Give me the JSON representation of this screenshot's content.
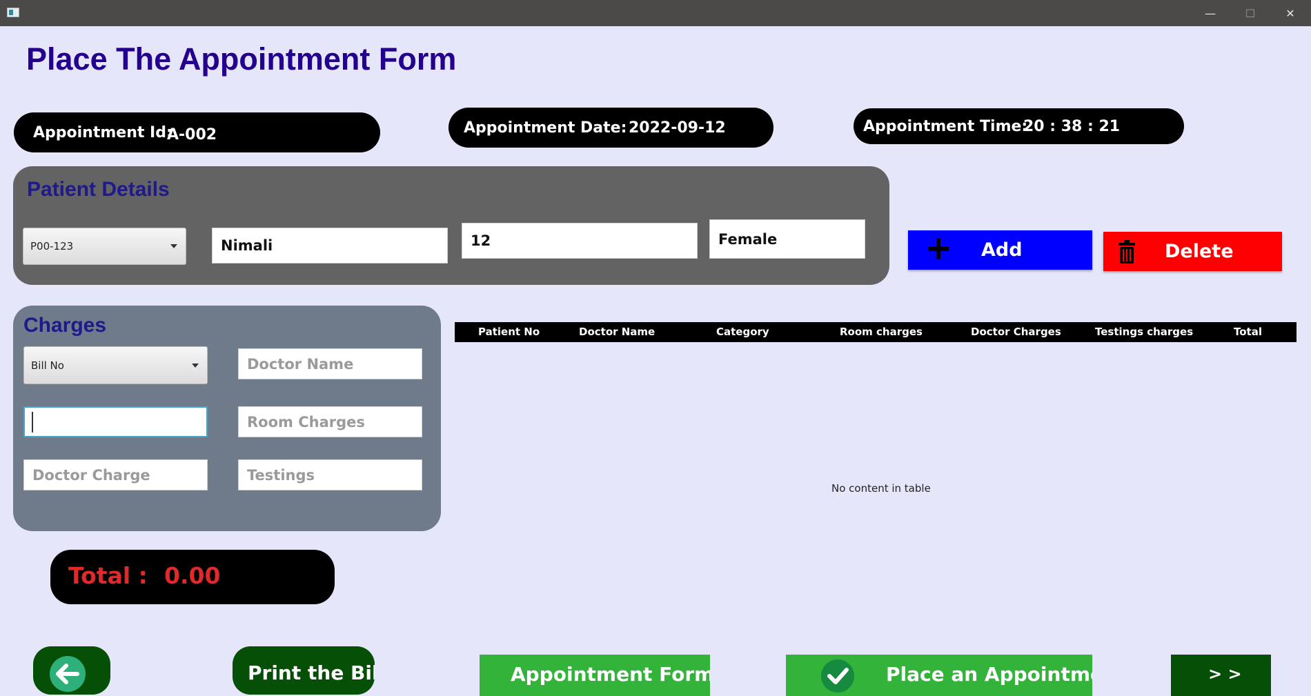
{
  "window": {
    "minimize_icon": "—",
    "maximize_icon": "☐",
    "close_icon": "✕"
  },
  "page_title": "Place The Appointment Form",
  "info": {
    "appointment_id_label": "Appointment Id:",
    "appointment_id_value": "A-002",
    "appointment_date_label": "Appointment Date:",
    "appointment_date_value": "2022-09-12",
    "appointment_time_label": "Appointment Time:",
    "appointment_time_value": "20 : 38 : 21"
  },
  "patient": {
    "heading": "Patient Details",
    "patient_id_selected": "P00-123",
    "name_value": "Nimali",
    "age_value": "12",
    "gender_value": "Female"
  },
  "actions": {
    "add_label": "Add",
    "delete_label": "Delete"
  },
  "charges": {
    "heading": "Charges",
    "bill_no_selected": "Bill No",
    "doctor_name_placeholder": "Doctor Name",
    "room_charges_placeholder": "Room Charges",
    "doctor_charge_placeholder": "Doctor Charge",
    "testings_placeholder": "Testings",
    "input_value": ""
  },
  "table": {
    "columns": [
      "Patient No",
      "Doctor Name",
      "Category",
      "Room charges",
      "Doctor Charges",
      "Testings charges",
      "Total"
    ],
    "rows": [],
    "empty_message": "No content in table"
  },
  "total": {
    "label": "Total :",
    "value": "0.00"
  },
  "bottom": {
    "back_icon": "arrow-left-icon",
    "print_label": "Print the Bill",
    "appointment_form_label": "Appointment Form",
    "place_appointment_label": "Place an Appointment",
    "next_label": "> >"
  },
  "colors": {
    "background": "#e6e6fa",
    "title": "#24008f",
    "add_button": "#0000ff",
    "delete_button": "#ff0000",
    "patient_panel": "#636363",
    "charges_panel": "#6f7b8b",
    "total_text": "#e02a2a",
    "green_button": "#34b33b",
    "dark_green_button": "#064f06"
  }
}
